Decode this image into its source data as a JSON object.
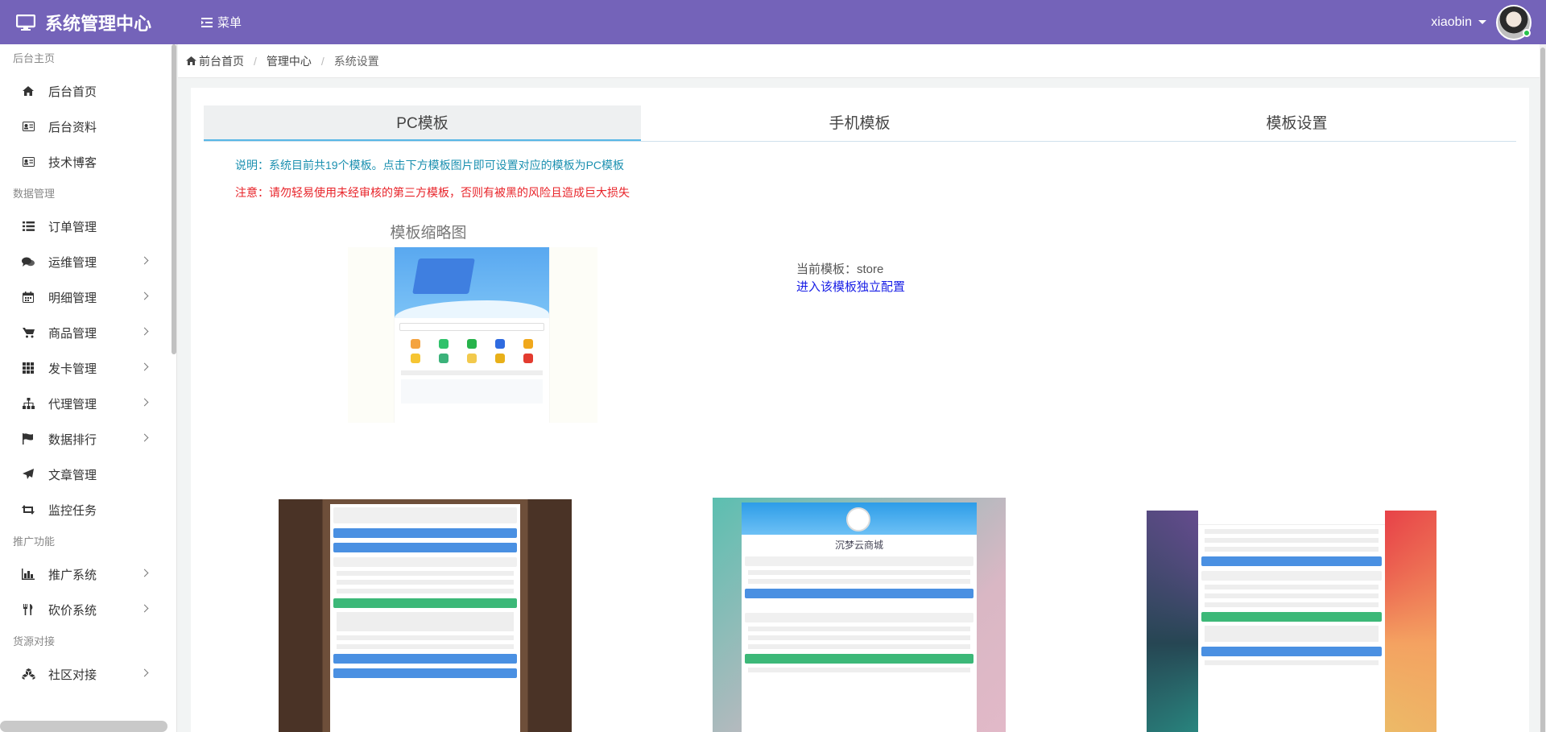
{
  "header": {
    "title": "系统管理中心",
    "menu_label": "菜单",
    "username": "xiaobin"
  },
  "sidebar": {
    "groups": [
      {
        "title": "后台主页",
        "items": [
          {
            "label": "后台首页",
            "icon": "home-icon",
            "has_sub": false
          },
          {
            "label": "后台资料",
            "icon": "id-card-icon",
            "has_sub": false
          },
          {
            "label": "技术博客",
            "icon": "id-card-icon",
            "has_sub": false
          }
        ]
      },
      {
        "title": "数据管理",
        "items": [
          {
            "label": "订单管理",
            "icon": "list-icon",
            "has_sub": false
          },
          {
            "label": "运维管理",
            "icon": "comments-icon",
            "has_sub": true
          },
          {
            "label": "明细管理",
            "icon": "calendar-icon",
            "has_sub": true
          },
          {
            "label": "商品管理",
            "icon": "cart-icon",
            "has_sub": true
          },
          {
            "label": "发卡管理",
            "icon": "grid-icon",
            "has_sub": true
          },
          {
            "label": "代理管理",
            "icon": "sitemap-icon",
            "has_sub": true
          },
          {
            "label": "数据排行",
            "icon": "flag-icon",
            "has_sub": true
          },
          {
            "label": "文章管理",
            "icon": "send-icon",
            "has_sub": false
          },
          {
            "label": "监控任务",
            "icon": "retweet-icon",
            "has_sub": false
          }
        ]
      },
      {
        "title": "推广功能",
        "items": [
          {
            "label": "推广系统",
            "icon": "bar-chart-icon",
            "has_sub": true
          },
          {
            "label": "砍价系统",
            "icon": "cutlery-icon",
            "has_sub": true
          }
        ]
      },
      {
        "title": "货源对接",
        "items": [
          {
            "label": "社区对接",
            "icon": "cubes-icon",
            "has_sub": true
          }
        ]
      }
    ]
  },
  "breadcrumb": {
    "home": "前台首页",
    "middle": "管理中心",
    "current": "系统设置"
  },
  "tabs": [
    "PC模板",
    "手机模板",
    "模板设置"
  ],
  "notice": {
    "info": "说明：系统目前共19个模板。点击下方模板图片即可设置对应的模板为PC模板",
    "warning": "注意：请勿轻易使用未经审核的第三方模板，否则有被黑的风险且造成巨大损失"
  },
  "thumbnail_title": "模板缩略图",
  "current_template": {
    "label": "当前模板：store",
    "link": "进入该模板独立配置"
  },
  "previews": {
    "store_name": "沉梦云商城"
  },
  "colors": {
    "topbar": "#7463b9",
    "info": "#1b90b0",
    "warning": "#e8242a",
    "link": "#1a20e6"
  }
}
